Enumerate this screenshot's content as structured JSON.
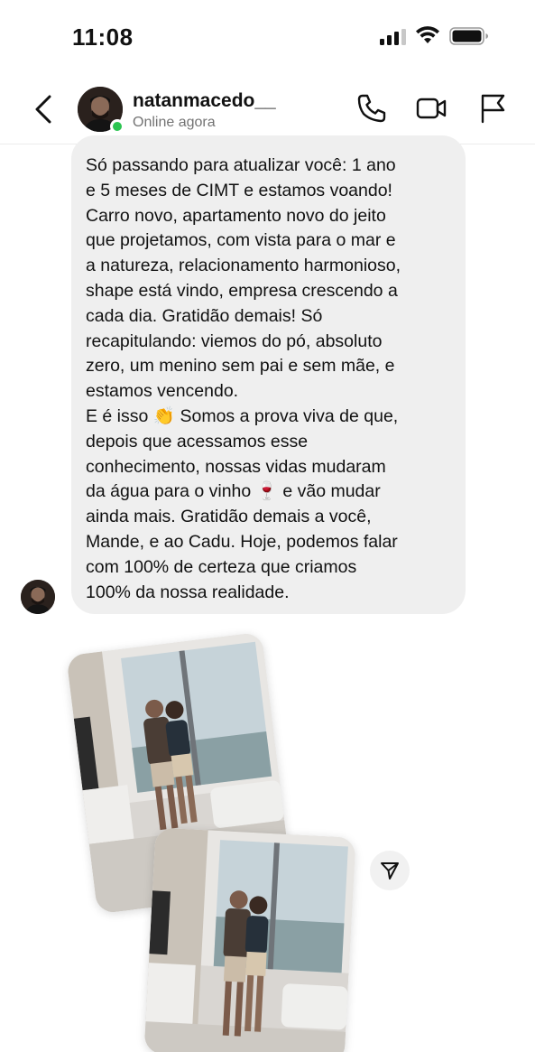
{
  "status_bar": {
    "time": "11:08"
  },
  "header": {
    "username": "natanmacedo__",
    "status": "Online agora"
  },
  "message": {
    "text": "Só passando para atualizar você: 1 ano\ne 5 meses de CIMT e estamos voando!\nCarro novo, apartamento novo do jeito\nque projetamos, com vista para o mar e\na natureza, relacionamento harmonioso,\nshape está vindo, empresa crescendo a\ncada dia. Gratidão demais! Só\nrecapitulando: viemos do pó, absoluto\nzero, um menino sem pai e sem mãe, e\nestamos vencendo.\nE é isso 👏 Somos a prova viva de que,\ndepois que acessamos esse\nconhecimento, nossas vidas mudaram\nda água para o vinho 🍷 e vão mudar\nainda mais. Gratidão demais a você,\nMande, e ao Cadu. Hoje, podemos falar\ncom 100% de certeza que criamos\n100% da nossa realidade."
  },
  "icons": {
    "back": "chevron-left-icon",
    "phone": "phone-icon",
    "video": "video-camera-icon",
    "flag": "flag-icon",
    "send": "send-icon"
  },
  "colors": {
    "bubble": "#efefef",
    "online": "#2bc450",
    "secondary_text": "#737373"
  }
}
